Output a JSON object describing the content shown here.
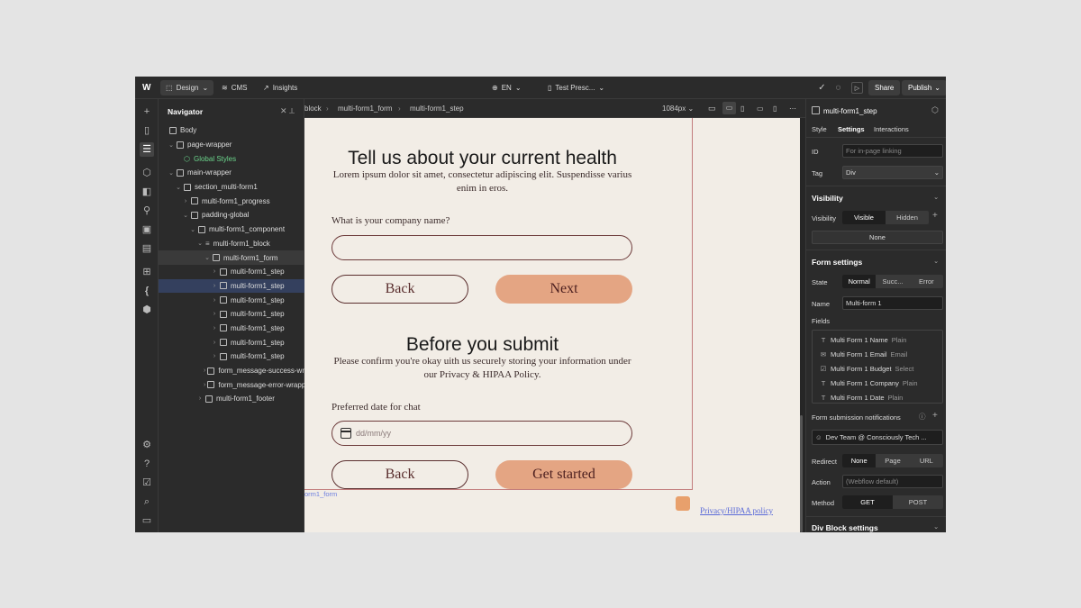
{
  "topbar": {
    "logo": "W",
    "design": "Design",
    "cms": "CMS",
    "insights": "Insights",
    "language": "EN",
    "page": "Test Presc...",
    "share": "Share",
    "publish": "Publish"
  },
  "navigator": {
    "title": "Navigator",
    "items": [
      {
        "label": "Body",
        "indent": 0
      },
      {
        "label": "page-wrapper",
        "indent": 1
      },
      {
        "label": "Global Styles",
        "indent": 2
      },
      {
        "label": "main-wrapper",
        "indent": 1
      },
      {
        "label": "section_multi-form1",
        "indent": 2
      },
      {
        "label": "multi-form1_progress",
        "indent": 3
      },
      {
        "label": "padding-global",
        "indent": 3
      },
      {
        "label": "multi-form1_component",
        "indent": 4
      },
      {
        "label": "multi-form1_block",
        "indent": 5
      },
      {
        "label": "multi-form1_form",
        "indent": 6
      },
      {
        "label": "multi-form1_step",
        "indent": 7
      },
      {
        "label": "multi-form1_step",
        "indent": 7
      },
      {
        "label": "multi-form1_step",
        "indent": 7
      },
      {
        "label": "multi-form1_step",
        "indent": 7
      },
      {
        "label": "multi-form1_step",
        "indent": 7
      },
      {
        "label": "multi-form1_step",
        "indent": 7
      },
      {
        "label": "multi-form1_step",
        "indent": 7
      },
      {
        "label": "form_message-success-wr",
        "indent": 6
      },
      {
        "label": "form_message-error-wrapp",
        "indent": 6
      },
      {
        "label": "multi-form1_footer",
        "indent": 5
      }
    ]
  },
  "canvas_bar": {
    "crumbs": [
      "block",
      "multi-form1_form",
      "multi-form1_step"
    ],
    "breakpoint": "1084px"
  },
  "canvas": {
    "heading1": "Tell us about your current health",
    "para1": "Lorem ipsum dolor sit amet, consectetur adipiscing elit. Suspendisse varius enim in eros.",
    "label1": "What is your company name?",
    "back1": "Back",
    "next": "Next",
    "heading2": "Before you submit",
    "para2": "Please confirm you're okay uith us securely storing your information under our Privacy & HIPAA Policy.",
    "label2": "Preferred date for chat",
    "date_placeholder": "dd/mm/yy",
    "back2": "Back",
    "get_started": "Get started",
    "form_tag": "orm1_form",
    "privacy_link": "Privacy/HIPAA policy"
  },
  "panel": {
    "element": "multi-form1_step",
    "tabs": [
      "Style",
      "Settings",
      "Interactions"
    ],
    "id_label": "ID",
    "id_placeholder": "For in-page linking",
    "tag_label": "Tag",
    "tag_value": "Div",
    "visibility_head": "Visibility",
    "visibility_label": "Visibility",
    "visible": "Visible",
    "hidden": "Hidden",
    "none": "None",
    "form_head": "Form settings",
    "state_label": "State",
    "state_options": [
      "Normal",
      "Succ...",
      "Error"
    ],
    "name_label": "Name",
    "name_value": "Multi-form 1",
    "fields_label": "Fields",
    "fields": [
      {
        "name": "Multi Form 1 Name",
        "type": "Plain",
        "icon": "T"
      },
      {
        "name": "Multi Form 1 Email",
        "type": "Email",
        "icon": "✉"
      },
      {
        "name": "Multi Form 1 Budget",
        "type": "Select",
        "icon": "☑"
      },
      {
        "name": "Multi Form 1 Company",
        "type": "Plain",
        "icon": "T"
      },
      {
        "name": "Multi Form 1 Date",
        "type": "Plain",
        "icon": "T"
      }
    ],
    "notif_label": "Form submission notifications",
    "notif_value": "Dev Team @ Consciously Tech ...",
    "redirect_label": "Redirect",
    "redirect_options": [
      "None",
      "Page",
      "URL"
    ],
    "action_label": "Action",
    "action_placeholder": "(Webflow default)",
    "method_label": "Method",
    "method_options": [
      "GET",
      "POST"
    ],
    "div_block_head": "Div Block settings"
  }
}
